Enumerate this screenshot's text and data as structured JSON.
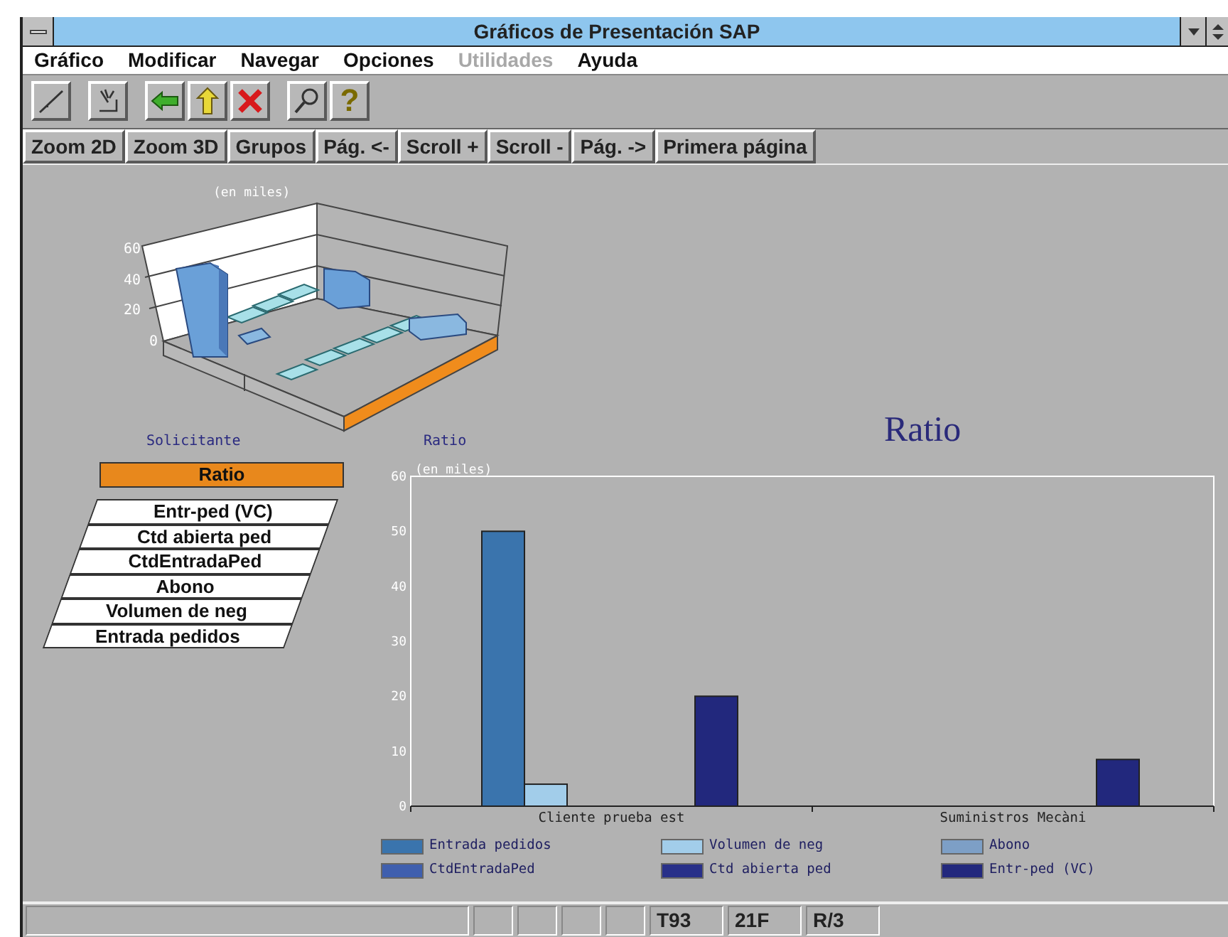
{
  "window": {
    "title": "Gráficos de Presentación SAP"
  },
  "menu": [
    {
      "label": "Gráfico",
      "disabled": false
    },
    {
      "label": "Modificar",
      "disabled": false
    },
    {
      "label": "Navegar",
      "disabled": false
    },
    {
      "label": "Opciones",
      "disabled": false
    },
    {
      "label": "Utilidades",
      "disabled": true
    },
    {
      "label": "Ayuda",
      "disabled": false
    }
  ],
  "toolbar": [
    {
      "kind": "line"
    },
    {
      "kind": "cursor"
    },
    {
      "kind": "back"
    },
    {
      "kind": "up"
    },
    {
      "kind": "cancel"
    },
    {
      "kind": "search"
    },
    {
      "kind": "help",
      "label": "?"
    }
  ],
  "buttons": [
    "Zoom 2D",
    "Zoom 3D",
    "Grupos",
    "Pág. <-",
    "Scroll +",
    "Scroll -",
    "Pág. ->",
    "Primera página"
  ],
  "chart3d": {
    "ylabel": "(en miles)",
    "yticks": [
      "60",
      "40",
      "20",
      "0"
    ],
    "axis_labels": [
      "Solicitante",
      "Ratio"
    ]
  },
  "key_figures": [
    {
      "label": "Ratio",
      "selected": true
    },
    {
      "label": "Entr-ped (VC)",
      "selected": false
    },
    {
      "label": "Ctd abierta ped",
      "selected": false
    },
    {
      "label": "CtdEntradaPed",
      "selected": false
    },
    {
      "label": "Abono",
      "selected": false
    },
    {
      "label": "Volumen de neg",
      "selected": false
    },
    {
      "label": "Entrada pedidos",
      "selected": false
    }
  ],
  "chart_data": {
    "type": "bar",
    "title": "Ratio",
    "ylabel": "(en miles)",
    "categories": [
      "Cliente prueba est",
      "Suministros Mecàni"
    ],
    "ylim": [
      0,
      60
    ],
    "yticks": [
      0,
      10,
      20,
      30,
      40,
      50,
      60
    ],
    "series": [
      {
        "name": "Entrada pedidos",
        "color": "#3a74ad",
        "values": [
          50,
          null
        ]
      },
      {
        "name": "Volumen de neg",
        "color": "#a2cdea",
        "values": [
          4,
          null
        ]
      },
      {
        "name": "Abono",
        "color": "#7d9fc6",
        "values": [
          null,
          null
        ]
      },
      {
        "name": "CtdEntradaPed",
        "color": "#3f5fae",
        "values": [
          null,
          null
        ]
      },
      {
        "name": "Ctd abierta ped",
        "color": "#283089",
        "values": [
          null,
          null
        ]
      },
      {
        "name": "Entr-ped (VC)",
        "color": "#22287d",
        "values": [
          20,
          8.5
        ]
      }
    ]
  },
  "status_bar": {
    "fields": [
      "T93",
      "21F",
      "R/3"
    ]
  }
}
